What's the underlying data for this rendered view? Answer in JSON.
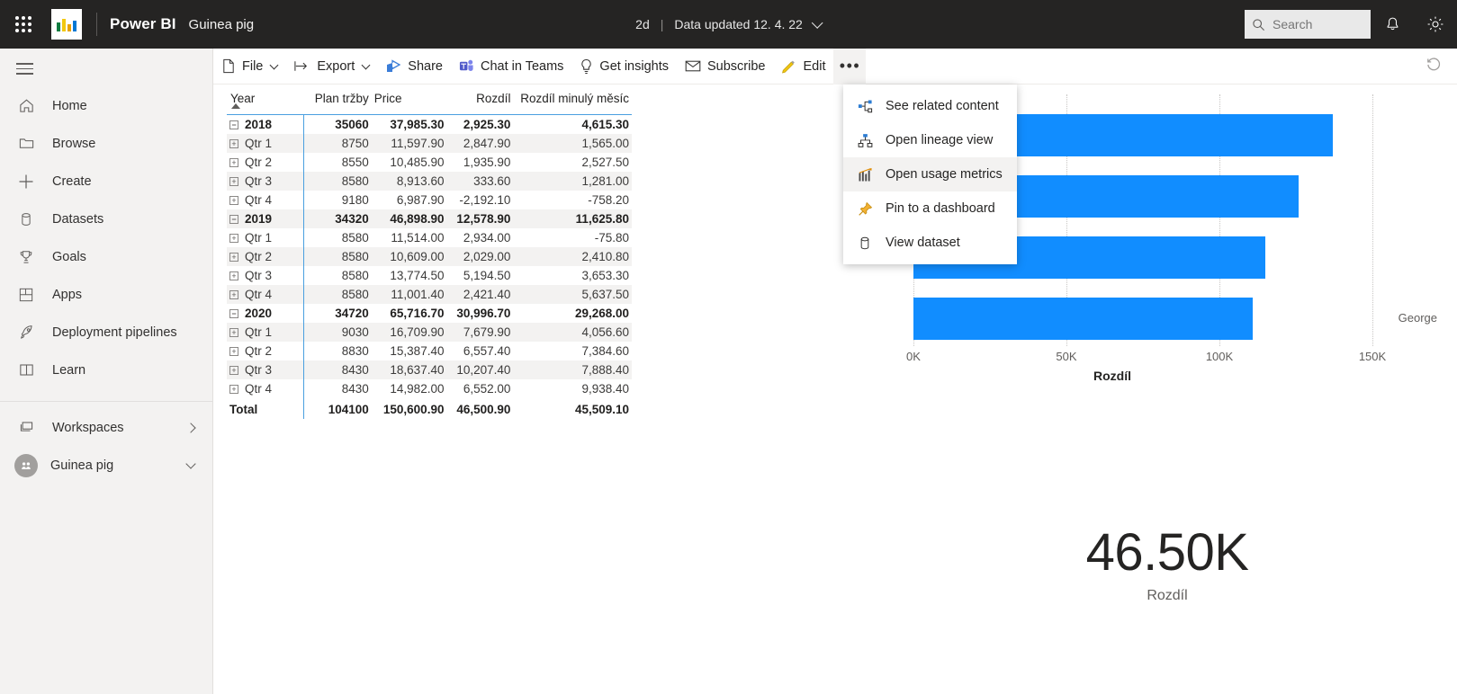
{
  "topbar": {
    "waffle_name": "app-launcher",
    "brand": "Power BI",
    "report_name": "Guinea pig",
    "refresh_age": "2d",
    "separator": "|",
    "data_updated": "Data updated 12. 4. 22",
    "search_placeholder": "Search",
    "search_value": ""
  },
  "actionbar": {
    "file": "File",
    "export": "Export",
    "share": "Share",
    "chat_in_teams": "Chat in Teams",
    "get_insights": "Get insights",
    "subscribe": "Subscribe",
    "edit": "Edit",
    "more": "•••"
  },
  "context_menu": {
    "items": [
      {
        "label": "See related content",
        "icon": "share-nodes-icon",
        "highlighted": false
      },
      {
        "label": "Open lineage view",
        "icon": "lineage-icon",
        "highlighted": false
      },
      {
        "label": "Open usage metrics",
        "icon": "usage-metrics-icon",
        "highlighted": true
      },
      {
        "label": "Pin to a dashboard",
        "icon": "pin-icon",
        "highlighted": false
      },
      {
        "label": "View dataset",
        "icon": "dataset-icon",
        "highlighted": false
      }
    ]
  },
  "sidebar": {
    "items": [
      {
        "label": "Home",
        "icon": "home-icon"
      },
      {
        "label": "Browse",
        "icon": "folder-icon"
      },
      {
        "label": "Create",
        "icon": "plus-icon"
      },
      {
        "label": "Datasets",
        "icon": "dataset-icon"
      },
      {
        "label": "Goals",
        "icon": "trophy-icon"
      },
      {
        "label": "Apps",
        "icon": "apps-icon"
      },
      {
        "label": "Deployment pipelines",
        "icon": "rocket-icon"
      },
      {
        "label": "Learn",
        "icon": "book-icon"
      }
    ],
    "workspaces": {
      "label": "Workspaces",
      "icon": "workspaces-icon"
    },
    "current_workspace": {
      "label": "Guinea pig",
      "avatar_initials": ""
    }
  },
  "matrix": {
    "columns": [
      "Year",
      "Plan tržby",
      "Price",
      "Rozdíl",
      "Rozdíl minulý měsíc"
    ],
    "rows": [
      {
        "type": "group",
        "indent": 0,
        "expander": "−",
        "label": "2018",
        "plan": "35060",
        "price": "37,985.30",
        "rozdil": "2,925.30",
        "rozdil_min": "4,615.30"
      },
      {
        "type": "child",
        "indent": 1,
        "expander": "+",
        "label": "Qtr 1",
        "plan": "8750",
        "price": "11,597.90",
        "rozdil": "2,847.90",
        "rozdil_min": "1,565.00"
      },
      {
        "type": "child",
        "indent": 1,
        "expander": "+",
        "label": "Qtr 2",
        "plan": "8550",
        "price": "10,485.90",
        "rozdil": "1,935.90",
        "rozdil_min": "2,527.50"
      },
      {
        "type": "child",
        "indent": 1,
        "expander": "+",
        "label": "Qtr 3",
        "plan": "8580",
        "price": "8,913.60",
        "rozdil": "333.60",
        "rozdil_min": "1,281.00"
      },
      {
        "type": "child",
        "indent": 1,
        "expander": "+",
        "label": "Qtr 4",
        "plan": "9180",
        "price": "6,987.90",
        "rozdil": "-2,192.10",
        "rozdil_min": "-758.20"
      },
      {
        "type": "group",
        "indent": 0,
        "expander": "−",
        "label": "2019",
        "plan": "34320",
        "price": "46,898.90",
        "rozdil": "12,578.90",
        "rozdil_min": "11,625.80"
      },
      {
        "type": "child",
        "indent": 1,
        "expander": "+",
        "label": "Qtr 1",
        "plan": "8580",
        "price": "11,514.00",
        "rozdil": "2,934.00",
        "rozdil_min": "-75.80"
      },
      {
        "type": "child",
        "indent": 1,
        "expander": "+",
        "label": "Qtr 2",
        "plan": "8580",
        "price": "10,609.00",
        "rozdil": "2,029.00",
        "rozdil_min": "2,410.80"
      },
      {
        "type": "child",
        "indent": 1,
        "expander": "+",
        "label": "Qtr 3",
        "plan": "8580",
        "price": "13,774.50",
        "rozdil": "5,194.50",
        "rozdil_min": "3,653.30"
      },
      {
        "type": "child",
        "indent": 1,
        "expander": "+",
        "label": "Qtr 4",
        "plan": "8580",
        "price": "11,001.40",
        "rozdil": "2,421.40",
        "rozdil_min": "5,637.50"
      },
      {
        "type": "group",
        "indent": 0,
        "expander": "−",
        "label": "2020",
        "plan": "34720",
        "price": "65,716.70",
        "rozdil": "30,996.70",
        "rozdil_min": "29,268.00"
      },
      {
        "type": "child",
        "indent": 1,
        "expander": "+",
        "label": "Qtr 1",
        "plan": "9030",
        "price": "16,709.90",
        "rozdil": "7,679.90",
        "rozdil_min": "4,056.60"
      },
      {
        "type": "child",
        "indent": 1,
        "expander": "+",
        "label": "Qtr 2",
        "plan": "8830",
        "price": "15,387.40",
        "rozdil": "6,557.40",
        "rozdil_min": "7,384.60"
      },
      {
        "type": "child",
        "indent": 1,
        "expander": "+",
        "label": "Qtr 3",
        "plan": "8430",
        "price": "18,637.40",
        "rozdil": "10,207.40",
        "rozdil_min": "7,888.40"
      },
      {
        "type": "child",
        "indent": 1,
        "expander": "+",
        "label": "Qtr 4",
        "plan": "8430",
        "price": "14,982.00",
        "rozdil": "6,552.00",
        "rozdil_min": "9,938.40"
      },
      {
        "type": "total",
        "indent": 0,
        "expander": "",
        "label": "Total",
        "plan": "104100",
        "price": "150,600.90",
        "rozdil": "46,500.90",
        "rozdil_min": "45,509.10"
      }
    ]
  },
  "kpi": {
    "value": "46.50K",
    "label": "Rozdíl"
  },
  "chart_data": {
    "type": "bar",
    "orientation": "horizontal",
    "title": "",
    "xlabel": "Rozdíl",
    "ylabel": "",
    "categories": [
      "",
      "",
      "",
      "George"
    ],
    "values": [
      137000,
      126000,
      115000,
      111000
    ],
    "xlim": [
      0,
      150000
    ],
    "xticks": [
      "0K",
      "50K",
      "100K",
      "150K"
    ],
    "xtick_values": [
      0,
      50000,
      100000,
      150000
    ],
    "grid": true,
    "legend": "none",
    "bar_color": "#118dff"
  }
}
